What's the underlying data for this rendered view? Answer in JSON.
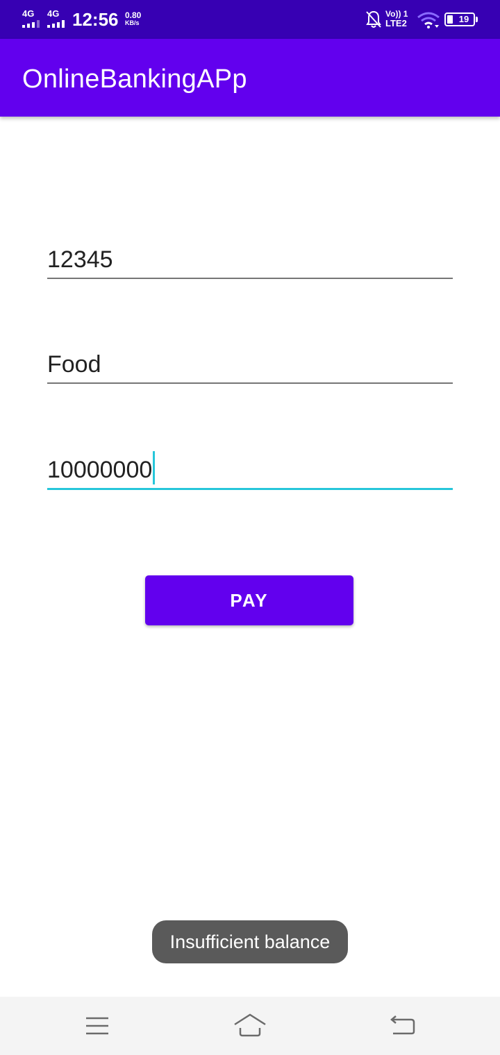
{
  "status_bar": {
    "network1": "4G",
    "network2": "4G",
    "time": "12:56",
    "speed_value": "0.80",
    "speed_unit": "KB/s",
    "volte_label": "Vo)) 1",
    "lte_label": "LTE2",
    "battery": "19",
    "icons": [
      "signal-icon",
      "signal-icon",
      "mute-notification-icon",
      "wifi-icon",
      "battery-icon"
    ]
  },
  "app_bar": {
    "title": "OnlineBankingAPp"
  },
  "form": {
    "account_value": "12345",
    "remark_value": "Food",
    "amount_value": "10000000",
    "pay_label": "PAY"
  },
  "toast": {
    "message": "Insufficient balance"
  },
  "nav_bar": {
    "icons": [
      "menu-icon",
      "home-icon",
      "back-icon"
    ]
  },
  "colors": {
    "status_bar": "#3700b3",
    "primary": "#6200ee",
    "accent": "#26c6da",
    "toast": "#5a5a5a"
  }
}
